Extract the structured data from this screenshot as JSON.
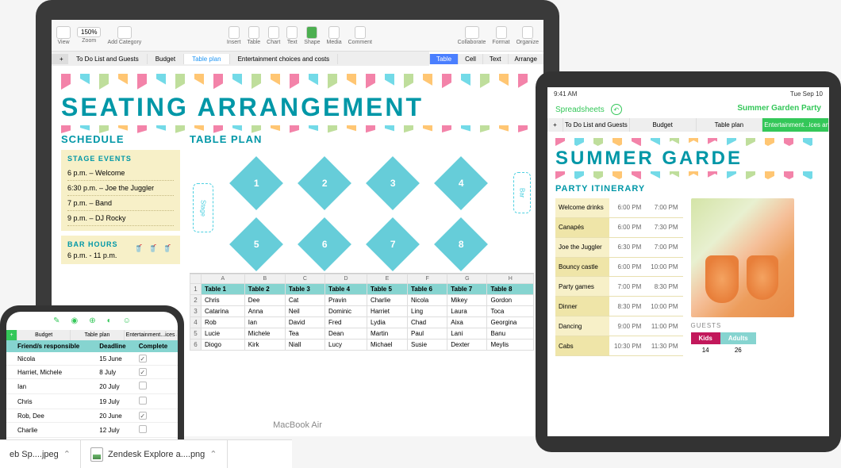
{
  "macbook": {
    "toolbar": {
      "view": "View",
      "zoom_val": "150%",
      "zoom": "Zoom",
      "add_category": "Add Category",
      "insert": "Insert",
      "table": "Table",
      "chart": "Chart",
      "text": "Text",
      "shape": "Shape",
      "media": "Media",
      "comment": "Comment",
      "collaborate": "Collaborate",
      "format": "Format",
      "organize": "Organize"
    },
    "doc_tabs": {
      "plus": "+",
      "t1": "To Do List and Guests",
      "t2": "Budget",
      "t3": "Table plan",
      "t4": "Entertainment choices and costs"
    },
    "right_tabs": {
      "r1": "Table",
      "r2": "Cell",
      "r3": "Text",
      "r4": "Arrange"
    },
    "title": "SEATING ARRANGEMENT",
    "schedule_heading": "SCHEDULE",
    "tableplan_heading": "TABLE PLAN",
    "stage_events": "STAGE EVENTS",
    "events": [
      "6 p.m. – Welcome",
      "6:30 p.m. – Joe the Juggler",
      "7 p.m. – Band",
      "9 p.m. – DJ Rocky"
    ],
    "bar_hours": "BAR HOURS",
    "bar_time": "6 p.m. - 11 p.m.",
    "stage_label": "Stage",
    "bar_label": "Bar",
    "table_nums": [
      "1",
      "2",
      "3",
      "4",
      "5",
      "6",
      "7",
      "8"
    ],
    "cols": [
      "A",
      "B",
      "C",
      "D",
      "E",
      "F",
      "G",
      "H"
    ],
    "headers": [
      "Table 1",
      "Table 2",
      "Table 3",
      "Table 4",
      "Table 5",
      "Table 6",
      "Table 7",
      "Table 8"
    ],
    "rows": [
      [
        "Chris",
        "Dee",
        "Cat",
        "Pravin",
        "Charlie",
        "Nicola",
        "Mikey",
        "Gordon"
      ],
      [
        "Catarina",
        "Anna",
        "Neil",
        "Dominic",
        "Harriet",
        "Ling",
        "Laura",
        "Toca"
      ],
      [
        "Rob",
        "Ian",
        "David",
        "Fred",
        "Lydia",
        "Chad",
        "Aixa",
        "Georgina"
      ],
      [
        "Lucie",
        "Michele",
        "Tea",
        "Dean",
        "Martin",
        "Paul",
        "Lani",
        "Banu"
      ],
      [
        "Diogo",
        "Kirk",
        "Niall",
        "Lucy",
        "Michael",
        "Susie",
        "Dexter",
        "Meylis"
      ]
    ],
    "rownums": [
      "1",
      "2",
      "3",
      "4",
      "5",
      "6"
    ],
    "device_label": "MacBook Air"
  },
  "ipad": {
    "status_time": "9:41 AM",
    "status_date": "Tue Sep 10",
    "nav_back": "Spreadsheets",
    "nav_title": "Summer Garden Party",
    "tabs": {
      "plus": "+",
      "t1": "To Do List and Guests",
      "t2": "Budget",
      "t3": "Table plan",
      "t4": "Entertainment...ices and c"
    },
    "title": "SUMMER GARDE",
    "section": "PARTY ITINERARY",
    "itin": [
      {
        "name": "Welcome drinks",
        "t1": "6:00 PM",
        "t2": "7:00 PM"
      },
      {
        "name": "Canapés",
        "t1": "6:00 PM",
        "t2": "7:30 PM"
      },
      {
        "name": "Joe the Juggler",
        "t1": "6:30 PM",
        "t2": "7:00 PM"
      },
      {
        "name": "Bouncy castle",
        "t1": "6:00 PM",
        "t2": "10:00 PM"
      },
      {
        "name": "Party games",
        "t1": "7:00 PM",
        "t2": "8:30 PM"
      },
      {
        "name": "Dinner",
        "t1": "8:30 PM",
        "t2": "10:00 PM"
      },
      {
        "name": "Dancing",
        "t1": "9:00 PM",
        "t2": "11:00 PM"
      },
      {
        "name": "Cabs",
        "t1": "10:30 PM",
        "t2": "11:30 PM"
      }
    ],
    "guests_label": "GUESTS",
    "guests": {
      "kids_h": "Kids",
      "adults_h": "Adults",
      "kids": "14",
      "adults": "26"
    }
  },
  "iphone": {
    "tabs": {
      "plus": "+",
      "t1": "Budget",
      "t2": "Table plan",
      "t3": "Entertainment...ices and costs"
    },
    "headers": {
      "h1": "Friend/s responsible",
      "h2": "Deadline",
      "h3": "Complete"
    },
    "rows": [
      {
        "n": "Nicola",
        "d": "15 June",
        "c": true
      },
      {
        "n": "Harriet, Michele",
        "d": "8 July",
        "c": true
      },
      {
        "n": "Ian",
        "d": "20 July",
        "c": false
      },
      {
        "n": "Chris",
        "d": "19 July",
        "c": false
      },
      {
        "n": "Rob, Dee",
        "d": "20 June",
        "c": true
      },
      {
        "n": "Charlie",
        "d": "12 July",
        "c": false
      }
    ]
  },
  "downloads": {
    "f1": "eb Sp....jpeg",
    "f2": "Zendesk Explore a....png"
  }
}
